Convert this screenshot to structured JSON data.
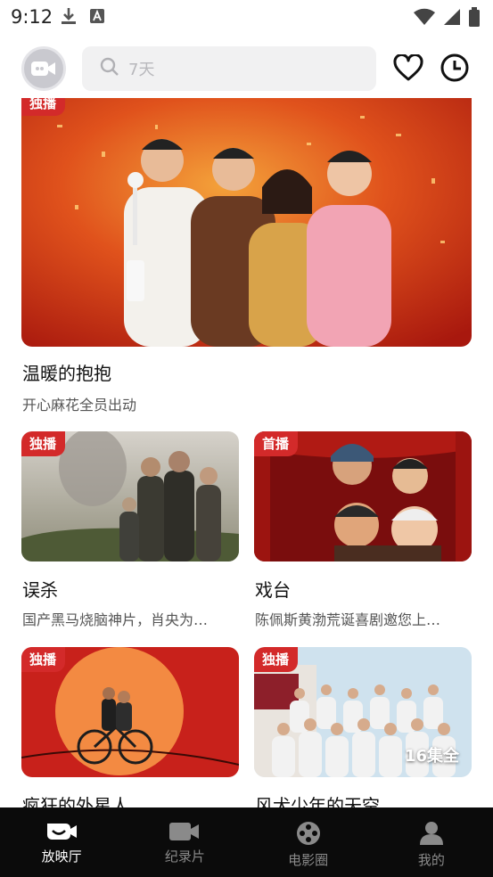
{
  "status_bar": {
    "time": "9:12"
  },
  "search": {
    "placeholder": "7天"
  },
  "colors": {
    "badge": "#d32a2a",
    "nav_bg": "#0b0b0b",
    "nav_active": "#ffffff",
    "nav_inactive": "#8a8a8a"
  },
  "hero": {
    "badge": "独播",
    "title": "温暖的抱抱",
    "subtitle": "开心麻花全员出动"
  },
  "cards": [
    {
      "badge": "独播",
      "title": "误杀",
      "subtitle": "国产黑马烧脑神片，肖央为…"
    },
    {
      "badge": "首播",
      "title": "戏台",
      "subtitle": "陈佩斯黄渤荒诞喜剧邀您上…"
    },
    {
      "badge": "独播",
      "title": "疯狂的外星人",
      "subtitle": ""
    },
    {
      "badge": "独播",
      "title": "风犬少年的天空",
      "subtitle": "",
      "episodes": "16集全"
    }
  ],
  "nav": [
    {
      "label": "放映厅",
      "icon": "theater-icon",
      "active": true
    },
    {
      "label": "纪录片",
      "icon": "video-camera-icon",
      "active": false
    },
    {
      "label": "电影圈",
      "icon": "film-reel-icon",
      "active": false
    },
    {
      "label": "我的",
      "icon": "person-icon",
      "active": false
    }
  ]
}
